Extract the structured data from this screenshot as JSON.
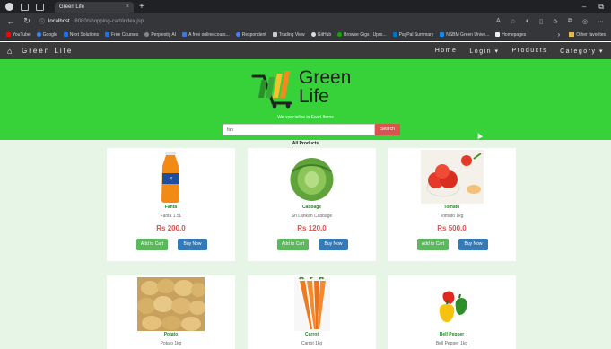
{
  "browser": {
    "tab_title": "Green Life",
    "tab_close": "×",
    "new_tab": "+",
    "url_host": "localhost",
    "url_path": ":8080/shopping-cart/index.jsp",
    "bookmarks": [
      {
        "label": "YouTube",
        "color": "#ff0000"
      },
      {
        "label": "Google",
        "color": "#4285f4"
      },
      {
        "label": "Next Solutions",
        "color": "#1a73e8"
      },
      {
        "label": "Free Courses",
        "color": "#1a73e8"
      },
      {
        "label": "Perplexity AI",
        "color": "#888888"
      },
      {
        "label": "A free online cours...",
        "color": "#3b78e7"
      },
      {
        "label": "Respondent",
        "color": "#4f7cff"
      },
      {
        "label": "Trading View",
        "color": "#cccccc"
      },
      {
        "label": "GitHub",
        "color": "#dddddd"
      },
      {
        "label": "Browse Gigs | Upro...",
        "color": "#14a800"
      },
      {
        "label": "PayPal Summary",
        "color": "#0070ba"
      },
      {
        "label": "NSBM Green Unive...",
        "color": "#1e88e5"
      },
      {
        "label": "Homepages",
        "color": "#eeeeee"
      }
    ],
    "bookmarks_more": "›",
    "other_favorites": "Other favorites"
  },
  "site_nav": {
    "brand": "Green Life",
    "links": [
      "Home",
      "Login ▾",
      "Products",
      "Category ▾"
    ]
  },
  "hero": {
    "logo_line1": "Green",
    "logo_line2": "Life",
    "tagline": "We specialize in Food Items",
    "search_value": "fan",
    "search_button": "Search"
  },
  "products": {
    "section_title": "All Products",
    "currency": "Rs",
    "add_to_cart_label": "Add to Cart",
    "buy_now_label": "Buy Now",
    "items": [
      {
        "name": "Fanta",
        "desc": "Fanta 1.5L",
        "price": "Rs 200.0"
      },
      {
        "name": "Cabbage",
        "desc": "Sri Lankan Cabbage",
        "price": "Rs 120.0"
      },
      {
        "name": "Tomato",
        "desc": "Tomato 1kg",
        "price": "Rs 500.0"
      },
      {
        "name": "Potato",
        "desc": "Potato 1kg",
        "price": ""
      },
      {
        "name": "Carrot",
        "desc": "Carrot 1kg",
        "price": ""
      },
      {
        "name": "Bell Pepper",
        "desc": "Bell Pepper 1kg",
        "price": ""
      }
    ]
  },
  "colors": {
    "hero_bg": "#37d23a",
    "navbar_bg": "#3a3a3a",
    "products_bg": "#e7f5e7",
    "price": "#d9534f",
    "add_to_cart": "#5cb85c",
    "buy_now": "#337ab7",
    "search_button": "#d9534f"
  }
}
